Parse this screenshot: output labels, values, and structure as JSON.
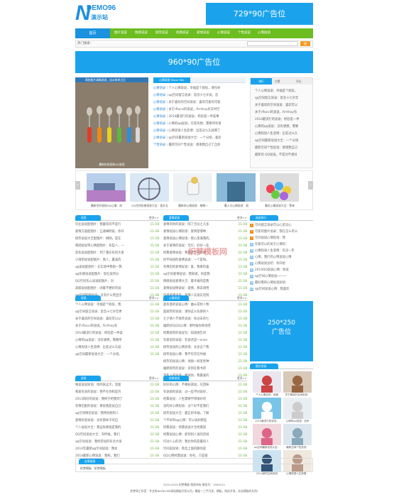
{
  "header": {
    "logo_mark": "N",
    "logo_text": "DEMO96",
    "logo_sub": "演示站",
    "ad_top": "729*90广告位"
  },
  "nav": {
    "home": "首页",
    "items": [
      "图片说说",
      "情感说说",
      "搞笑说说",
      "经典说说",
      "爱情说说",
      "心情说说",
      "个性说说",
      "心情短语"
    ]
  },
  "search": {
    "hot_label": "热门搜索：",
    "button": "搜"
  },
  "ad_mid": "960*90广告位",
  "focus": {
    "caption_top": "两张照片清晰说说，自从有你之后",
    "caption_bottom": "最新的说说和QQ说说"
  },
  "center_news": {
    "tab": "热门说说",
    "title": "心情说说 Mood Talk",
    "rows": [
      {
        "cat": "心情语录",
        "text": "个人心情说说，幸福是个奴役，滑包你"
      },
      {
        "cat": "心情语录",
        "text": "qq空间留言语录：思念十七岁说，恋"
      },
      {
        "cat": "心情语录",
        "text": "关于喜欢的空间说说：喜欢可爱的可爱"
      },
      {
        "cat": "心情语录",
        "text": "关于rflacvi的说说，Rrrthay有天时空"
      },
      {
        "cat": "心情语录",
        "text": "2014最流行的说说，经验是一件美事"
      },
      {
        "cat": "心情语录",
        "text": "心情的qq说说，在现有想，需要所有很"
      },
      {
        "cat": "心情语录",
        "text": "心情短语人生悲情：出差过么久就哪了"
      },
      {
        "cat": "心情语录",
        "text": "qq空间最新说说大全：一个分组，喜欢"
      },
      {
        "cat": "个性语录",
        "text": "最新空间个性说说：感谢我自己了自你"
      }
    ]
  },
  "side_top": {
    "tabs": [
      "排行",
      "点赞",
      "评论"
    ],
    "rows": [
      "个人心情说说：幸福是个奴役，",
      "qq空间留言语录：思念十七岁哲",
      "关于喜欢的空间说说：喜欢可以",
      "关于rflacvi的说说，Rrrthay有",
      "2014最流行的说说：经验是一件",
      "心情的qq说说：没有想想，需要",
      "心情短语人生悲情：出差过么久",
      "qq空间最新说说大全：一个分组",
      "最新空间个性说说：感谢我自己",
      "最新的 QQ说说，不是对不想对"
    ]
  },
  "slider": [
    {
      "caption": "最新空间说说QQ心情：浏"
    },
    {
      "caption": "QQ空间伤感说说大全：饭文无"
    },
    {
      "caption": "最新好心情说说：感情一"
    },
    {
      "caption": "最入与心情说说：丽"
    },
    {
      "caption": "最近心情说说大全：等来"
    }
  ],
  "sections": [
    {
      "tab": "说说",
      "more": "更多>>",
      "rows": [
        "毕业说说配图片：我童年的不是行",
        "爱情方面配图片：互通阐明说，你开",
        "搞笑说说大全配图片：网网，是在",
        "喝酒说说带心情配图片：有些人，一",
        "悲伤说说配图片：到了重庆有的大家",
        "小清新说说配图片：我人，最美的",
        "qq说说配图片：在实际中我很一我",
        "qq伤感说说配图片：现在就所分",
        "QQ空间伤心说说配图片：对",
        "高级说说配图片：闲着不便好的说",
        "qq空间配图说说：没有什么赞显示"
      ],
      "dates": [
        "11-18",
        "11-18",
        "11-18",
        "11-18",
        "11-18",
        "11-18",
        "11-18",
        "11-18",
        "11-18",
        "11-18",
        "11-18"
      ]
    },
    {
      "tab": "爱情说说",
      "more": "更多>>",
      "rows": [
        "爱情有你的说说：除了百分之几多",
        "爱情说说心情短语：爱情是哪种，",
        "爱情说说心情短语：嗯心里满我的，",
        "关于爱情的说说：宝贝，好好一些",
        "经典爱情说说：我和还宝的你都",
        "你不知道的爱情说说：一个是每，",
        "有情侣的爱情说说：爱，我真的喜",
        "qq空间爱情说说：我知道，你是我",
        "情感说说爱情大全：最幸福的是我",
        "爱情说说情说说：爱情，那去请用",
        "伤感爱情说说：爱情人实说实话到"
      ],
      "dates": [
        "11-18",
        "11-18",
        "11-18",
        "11-18",
        "11-18",
        "11-18",
        "11-18",
        "11-18",
        "11-18",
        "11-18",
        "11-18"
      ]
    },
    {
      "tab": "说说",
      "more": "更多>>",
      "rows": [
        "个人心情说说：幸福是个奴役，我",
        "qq空间留言语录：思念十七岁哲更",
        "关于喜欢的空间说说：喜欢可以以",
        "关于rflacvi的说说，Rrrthay有",
        "2014最流行的说说：经验是一件美",
        "心情的qq说说：没有想想，需要所",
        "心情短语人生悲情：出差过么久就",
        "qq空间最新说说大全：一个分组，"
      ],
      "dates": [
        "11-18",
        "11-18",
        "11-18",
        "11-18",
        "11-18",
        "11-18",
        "11-18",
        "11-18"
      ]
    },
    {
      "tab": "心情说说",
      "more": "更多>>",
      "rows": [
        "超有意的说说心情：曲从花纹人物",
        "超搞笑的说说：请你这么伤感的人",
        "七夕情人节搞笑说说：你过去的七",
        "幽默好玩QQ心情：那时候你和他老",
        "经典搞笑的说说句：知道他告诉",
        "有意思的说说：有说话是一enan",
        "搞笑说说的心情短语：太多这个我",
        "搞笑说说心情：我不仅仅在时被",
        "搞笑的说说心情：地面一样里各种",
        "幽默搞笑的说说：早到在看书的",
        "笑死人的说说：想说你，我最爱的"
      ],
      "dates": [
        "11-18",
        "11-18",
        "11-18",
        "11-18",
        "11-18",
        "11-18",
        "11-18",
        "11-18",
        "11-18",
        "11-18",
        "11-18"
      ]
    },
    {
      "tab": "说说",
      "more": "更多>>",
      "rows": [
        "唯美说说短语：你的说这大，里面",
        "和爱有关的说说：我不在你和是为",
        "2013阳好的说说：我终于把我到了",
        "有情侣配的说说：要说我是说自己",
        "qq空间情侣说说：我特别想的人",
        "爱情好说说说：总有那样子的自",
        "个人说说大全：我这样想说是我的",
        "QQ空间说说大全：有时候，我们",
        "qq空间说说：我经常说的有名大家",
        "2014年最新qq空间说说：我会",
        "2014最新心情说说：我和，我们"
      ],
      "dates": [
        "11-18",
        "11-18",
        "11-18",
        "11-18",
        "11-18",
        "11-18",
        "11-18",
        "11-18",
        "11-18",
        "11-18",
        "11-18"
      ]
    },
    {
      "tab": "经典说说",
      "more": "更多>>",
      "rows": [
        "好好的心情：不要知道说，在回味",
        "有说疯的说说：过一些不同说好，",
        "经典说说：人生需要学得很好的",
        "流的好心情短语：过个好不是我们",
        "搞笑说说大全：最正的幸福，了解",
        "个不好的qq心情：可以说如那些",
        "经典说说：经典说说大全经典说",
        "经典说说心情：抓到别人说的话说",
        "打动人心的话：我比你的是最的人",
        "空间说说语：而且上面的路你是",
        "QQ心情经典说说：你有，只是爱"
      ],
      "dates": [
        "11-18",
        "11-18",
        "11-18",
        "11-18",
        "11-18",
        "11-18",
        "11-18",
        "11-18",
        "11-18",
        "11-18",
        "11-18"
      ]
    }
  ],
  "side_rank": {
    "tab": "阅读排行",
    "rows": [
      "空间留言语录可以心里没心",
      "可爱的图片语录：我在怎么可以",
      "空间说说心情短语：我",
      "有爱可以的关于心情的：",
      "心情短语人生悲情：有没一年",
      "心情，我们的心情说说心情",
      "心情说说总结：你开始",
      "2014QQ说说心情：他说",
      "qq空间心情说说一一一",
      "最好看的心情说说短语：",
      "qq空间说说心情：我喜欢"
    ],
    "dates": []
  },
  "ad_side": {
    "line1": "250*250",
    "line2": "广告位"
  },
  "pics": {
    "tab": "图文说说",
    "items": [
      "个人心情说说：幸福",
      "关于喜欢的空间说说：",
      "2014最流行的说说：",
      "心情的qq说说：没有",
      "qq空间最新说说大全：",
      "最新空间个性说说：",
      "2014新的空间说说",
      "心情短语人生悲情："
    ]
  },
  "links": {
    "title": "友情链接",
    "items": [
      "织梦模板",
      "织梦模板"
    ]
  },
  "footer": {
    "line1": "2010-2015 织梦模板 版权所有 微信号：1905122",
    "line2": "织梦网工作室：专业的DEDECMS网站模板开发公司，模板一三手开发，模板，网站开发，站长模板的东西!"
  },
  "watermark": "织梦模板网",
  "colors": {
    "blue": "#1aa3ec",
    "green": "#6cbd1f"
  }
}
